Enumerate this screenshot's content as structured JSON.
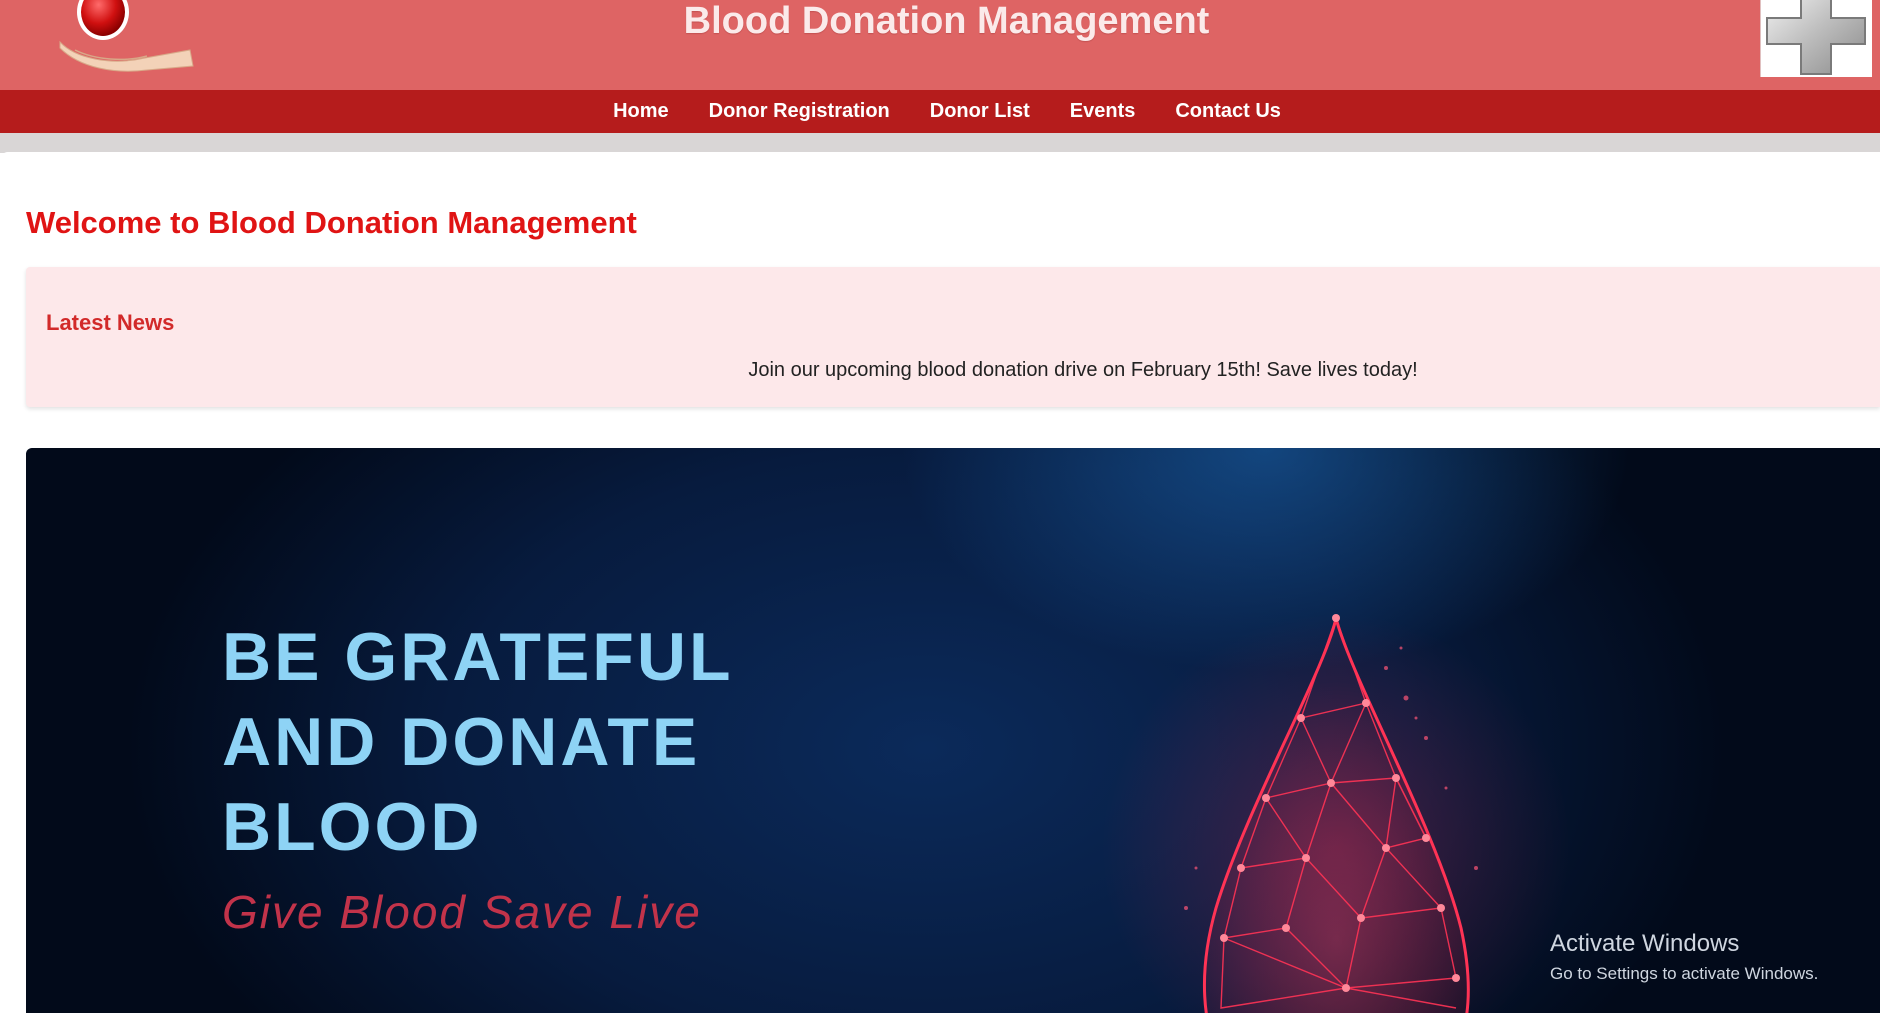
{
  "header": {
    "title": "Blood Donation Management",
    "colors": {
      "header_bg": "#de6464",
      "nav_bg": "#b51c1c"
    }
  },
  "nav": {
    "items": [
      {
        "label": "Home"
      },
      {
        "label": "Donor Registration"
      },
      {
        "label": "Donor List"
      },
      {
        "label": "Events"
      },
      {
        "label": "Contact Us"
      }
    ]
  },
  "main": {
    "welcome": "Welcome to Blood Donation Management",
    "news": {
      "title": "Latest News",
      "text": "Join our upcoming blood donation drive on February 15th! Save lives today!"
    },
    "banner": {
      "lines": [
        "BE GRATEFUL",
        "AND DONATE",
        "BLOOD"
      ],
      "tagline": "Give Blood  Save Live"
    }
  },
  "os_overlay": {
    "title": "Activate Windows",
    "subtitle": "Go to Settings to activate Windows."
  },
  "icons": [
    "blood-drop-hand-logo",
    "medical-cross-icon",
    "polygon-blood-drop-icon"
  ]
}
